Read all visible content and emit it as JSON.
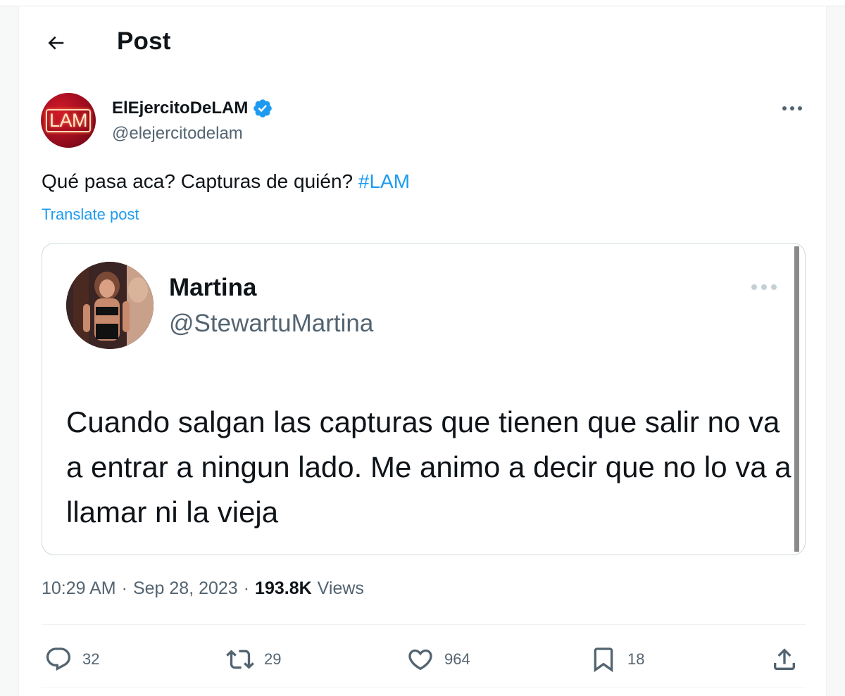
{
  "header": {
    "title": "Post",
    "back_icon": "arrow-left-icon"
  },
  "author": {
    "name": "ElEjercitoDeLAM",
    "handle": "@elejercitodelam",
    "avatar_text": "LAM",
    "verified_color": "#1d9bf0"
  },
  "post": {
    "text": "Qué pasa aca? Capturas de quién? ",
    "hashtag": "#LAM",
    "translate_label": "Translate post"
  },
  "quoted": {
    "name": "Martina",
    "handle": "@StewartuMartina",
    "body": "Cuando salgan las capturas que tienen que salir no va a entrar a ningun lado. Me animo a decir que no lo va a llamar ni la vieja"
  },
  "meta": {
    "time": "10:29 AM",
    "separator": "·",
    "date": "Sep 28, 2023",
    "views_count": "193.8K",
    "views_label": "Views"
  },
  "actions": {
    "replies": "32",
    "reposts": "29",
    "likes": "964",
    "bookmarks": "18"
  },
  "colors": {
    "accent": "#1d9bf0",
    "secondary_text": "#536471",
    "primary_text": "#0f1419"
  }
}
